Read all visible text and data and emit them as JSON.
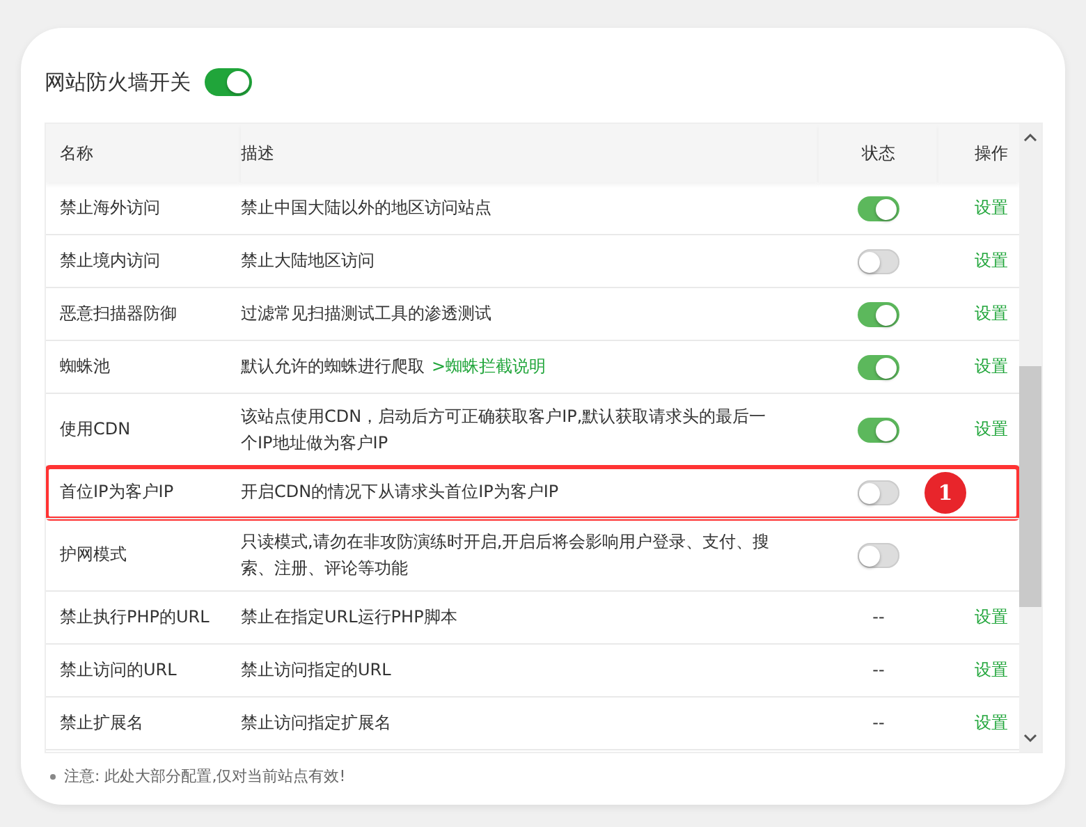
{
  "header": {
    "title": "网站防火墙开关",
    "on": true
  },
  "table": {
    "columns": [
      "名称",
      "描述",
      "状态",
      "操作"
    ],
    "rows": [
      {
        "name": "禁止海外访问",
        "description": "禁止中国大陆以外的地区访问站点",
        "status": {
          "kind": "toggle",
          "on": true
        },
        "action": "设置",
        "highlighted": false
      },
      {
        "name": "禁止境内访问",
        "description": "禁止大陆地区访问",
        "status": {
          "kind": "toggle",
          "on": false
        },
        "action": "设置",
        "highlighted": false
      },
      {
        "name": "恶意扫描器防御",
        "description": "过滤常见扫描测试工具的渗透测试",
        "status": {
          "kind": "toggle",
          "on": true
        },
        "action": "设置",
        "highlighted": false
      },
      {
        "name": "蜘蛛池",
        "description": "默认允许的蜘蛛进行爬取",
        "link": ">蜘蛛拦截说明",
        "status": {
          "kind": "toggle",
          "on": true
        },
        "action": "设置",
        "highlighted": false
      },
      {
        "name": "使用CDN",
        "description": "该站点使用CDN，启动后方可正确获取客户IP,默认获取请求头的最后一个IP地址做为客户IP",
        "status": {
          "kind": "toggle",
          "on": true
        },
        "action": "设置",
        "highlighted": false
      },
      {
        "name": "首位IP为客户IP",
        "description": "开启CDN的情况下从请求头首位IP为客户IP",
        "status": {
          "kind": "toggle",
          "on": false
        },
        "highlighted": true,
        "badge": "1"
      },
      {
        "name": "护网模式",
        "description": "只读模式,请勿在非攻防演练时开启,开启后将会影响用户登录、支付、搜索、注册、评论等功能",
        "status": {
          "kind": "toggle",
          "on": false
        },
        "highlighted": false
      },
      {
        "name": "禁止执行PHP的URL",
        "description": "禁止在指定URL运行PHP脚本",
        "status": {
          "kind": "text",
          "text": "--"
        },
        "action": "设置",
        "highlighted": false
      },
      {
        "name": "禁止访问的URL",
        "description": "禁止访问指定的URL",
        "status": {
          "kind": "text",
          "text": "--"
        },
        "action": "设置",
        "highlighted": false
      },
      {
        "name": "禁止扩展名",
        "description": "禁止访问指定扩展名",
        "status": {
          "kind": "text",
          "text": "--"
        },
        "action": "设置",
        "highlighted": false
      }
    ]
  },
  "note": "注意: 此处大部分配置,仅对当前站点有效!"
}
